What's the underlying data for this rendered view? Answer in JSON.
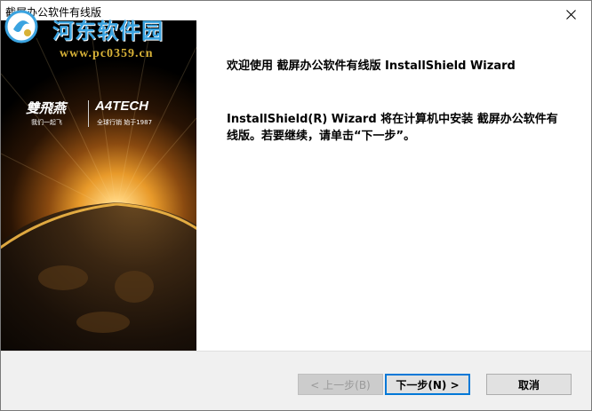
{
  "window": {
    "title": "截屏办公软件有线版"
  },
  "watermark": {
    "site_name": "河东软件园",
    "url": "www.pc0359.cn"
  },
  "side_image": {
    "brand_left": "雙飛燕",
    "brand_left_sub": "我们一起飞",
    "brand_right": "A4TECH",
    "brand_right_sub": "全球行销  始于1987"
  },
  "content": {
    "welcome": "欢迎使用 截屏办公软件有线版 InstallShield Wizard",
    "description": "InstallShield(R) Wizard 将在计算机中安装 截屏办公软件有线版。若要继续，请单击“下一步”。"
  },
  "buttons": {
    "back": "< 上一步(B)",
    "next": "下一步(N) >",
    "cancel": "取消"
  },
  "colors": {
    "watermark_blue": "#3aa3e0",
    "watermark_gold": "#d8b237",
    "default_button_border": "#0078d7"
  }
}
